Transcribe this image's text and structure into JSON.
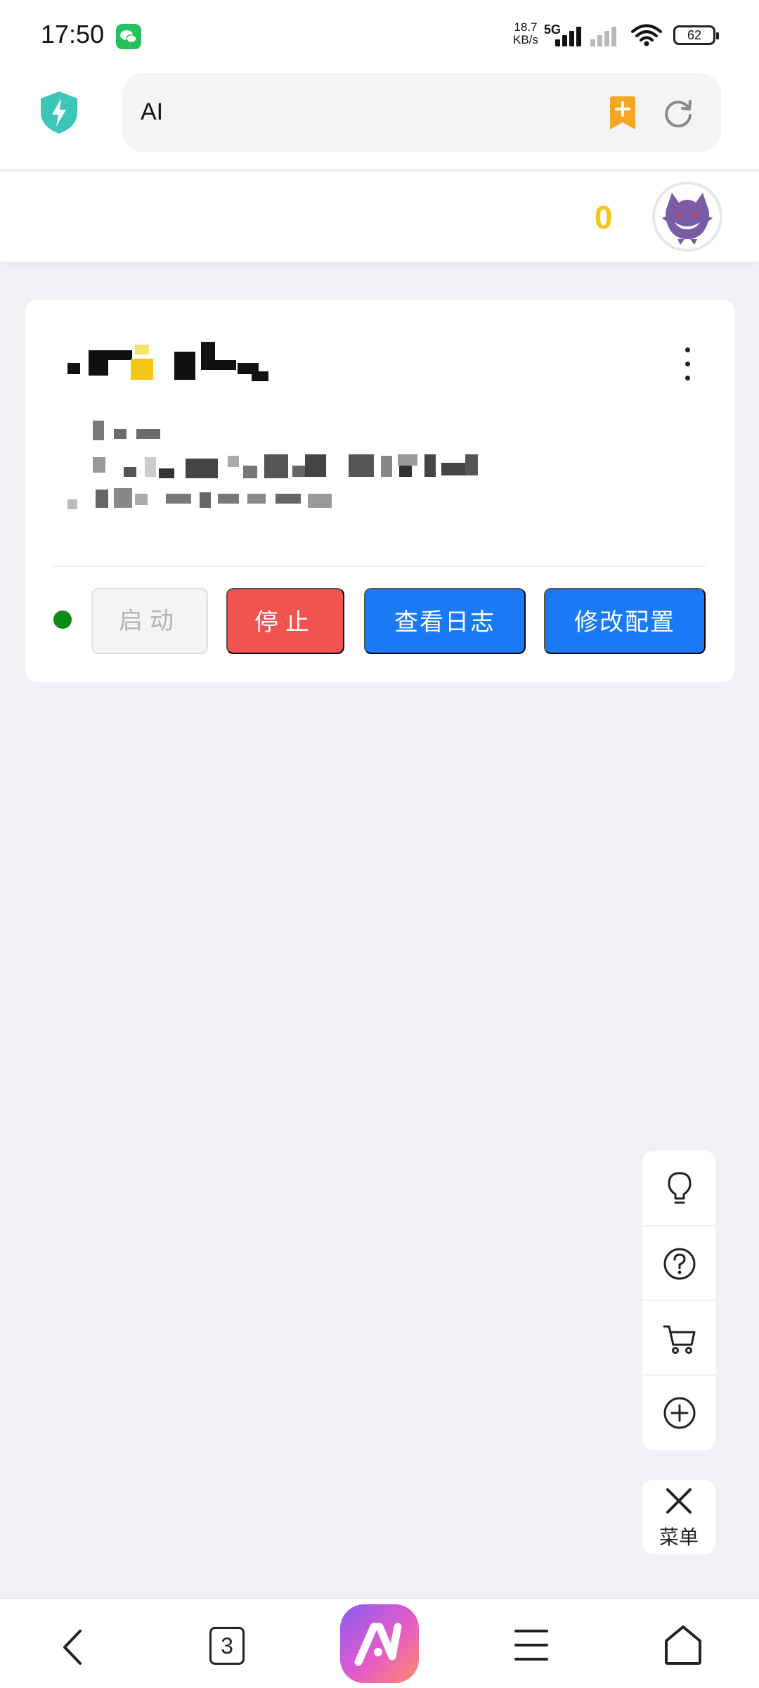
{
  "status_bar": {
    "time": "17:50",
    "net_speed_value": "18.7",
    "net_speed_unit": "KB/s",
    "network": "5G",
    "battery": "62",
    "icons": [
      "wechat-icon",
      "signal-icon",
      "wifi-icon",
      "battery-icon"
    ]
  },
  "address_bar": {
    "url_text": "AI",
    "icons": [
      "shield-icon",
      "bookmark-add-icon",
      "reload-icon"
    ],
    "accent": "#f5a623"
  },
  "user": {
    "score": "0",
    "score_color": "#f5c518"
  },
  "card": {
    "content_redacted": true,
    "status_color": "#0e8a18",
    "buttons": {
      "start": "启动",
      "stop": "停止",
      "view_logs": "查看日志",
      "edit_config": "修改配置"
    },
    "colors": {
      "stop": "#f25350",
      "primary": "#1a79f5"
    }
  },
  "float_tools": {
    "items": [
      "lightbulb-icon",
      "help-icon",
      "cart-icon",
      "add-icon"
    ],
    "menu_label": "菜单"
  },
  "bottom_nav": {
    "tab_count": "3",
    "icons": [
      "back-icon",
      "tabs-icon",
      "home-logo-icon",
      "menu-icon",
      "home-icon"
    ]
  }
}
